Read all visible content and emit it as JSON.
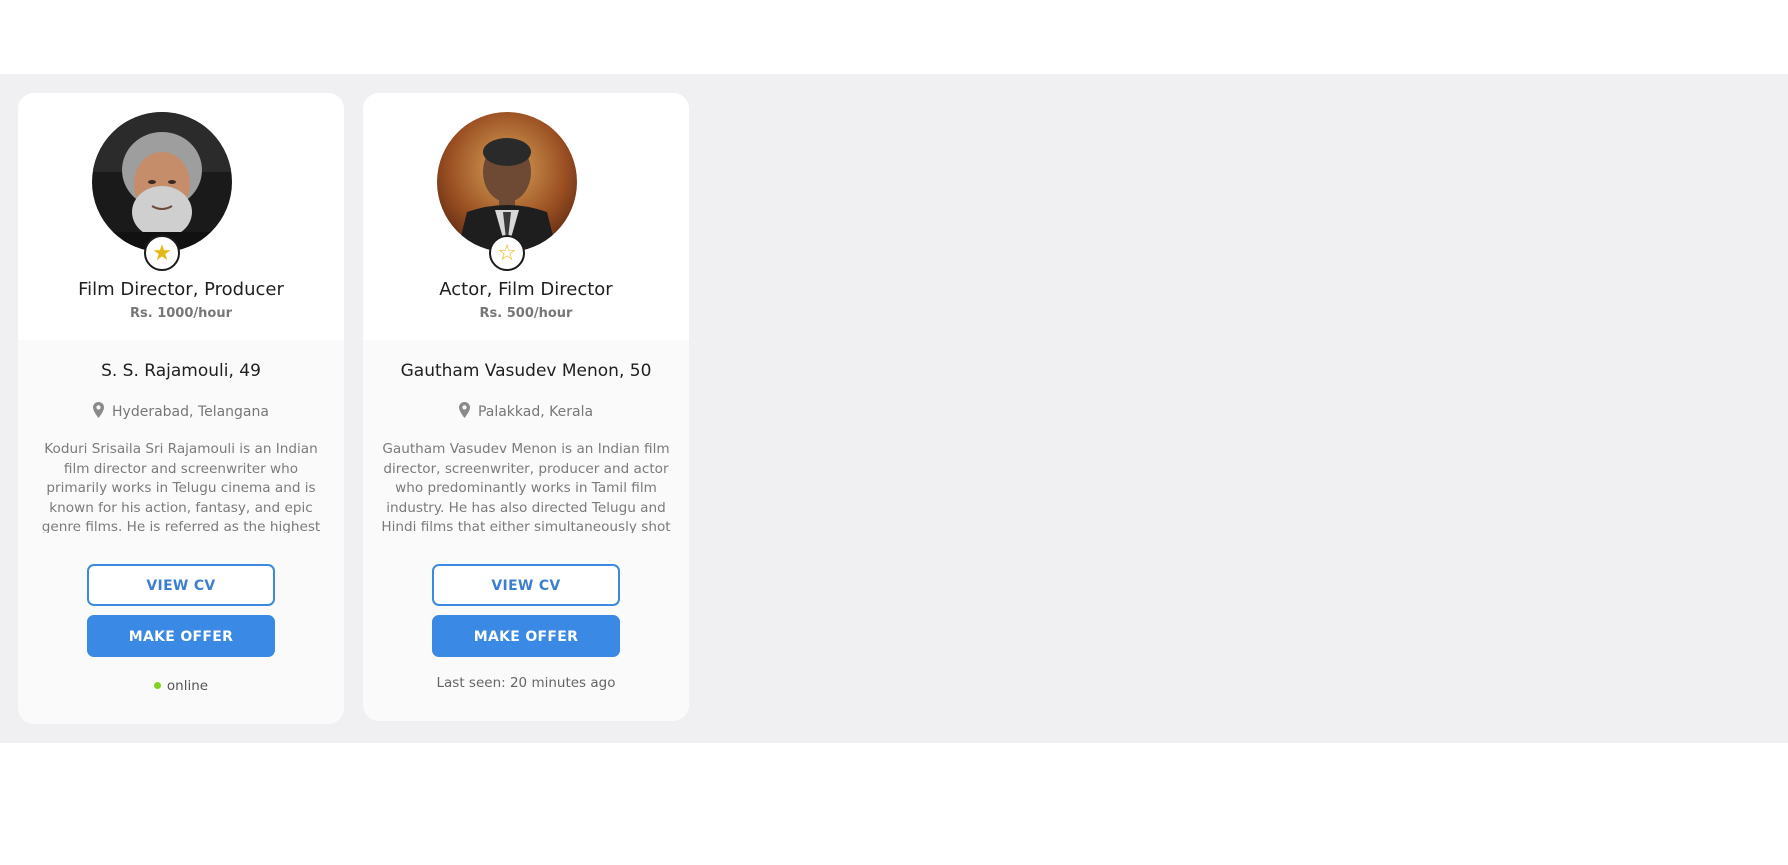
{
  "theme": {
    "accent": "#3a89e4",
    "band_background": "#f0f0f2",
    "star_color": "#e5b711",
    "online_color": "#7ed321"
  },
  "profiles": [
    {
      "favorite": true,
      "star_glyph": "★",
      "role": "Film Director, Producer",
      "rate": "Rs. 1000/hour",
      "name": "S. S. Rajamouli, 49",
      "location": "Hyderabad, Telangana",
      "bio": "Koduri Srisaila Sri Rajamouli is an Indian film director and screenwriter who primarily works in Telugu cinema and is known for his action, fantasy, and epic genre films. He is referred as the highest grossing Indian",
      "view_cv_label": "VIEW CV",
      "make_offer_label": "MAKE OFFER",
      "status": "online",
      "is_online": true
    },
    {
      "favorite": false,
      "star_glyph": "☆",
      "role": "Actor, Film Director",
      "rate": "Rs. 500/hour",
      "name": "Gautham Vasudev Menon, 50",
      "location": "Palakkad, Kerala",
      "bio": "Gautham Vasudev Menon is an Indian film director, screenwriter, producer and actor who predominantly works in Tamil film industry. He has also directed Telugu and Hindi films that either simultaneously shot",
      "view_cv_label": "VIEW CV",
      "make_offer_label": "MAKE OFFER",
      "status": "Last seen: 20 minutes ago",
      "is_online": false
    }
  ]
}
